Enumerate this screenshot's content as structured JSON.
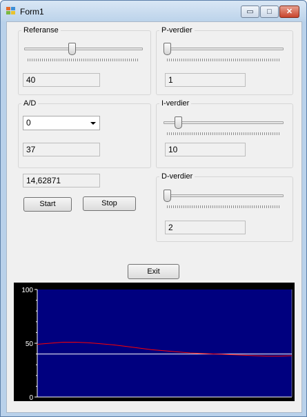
{
  "window": {
    "title": "Form1"
  },
  "controls": {
    "minimize": "▭",
    "maximize": "□",
    "close": "✕"
  },
  "referanse": {
    "label": "Referanse",
    "slider_value": 40,
    "slider_max": 100,
    "value": "40"
  },
  "p_verdier": {
    "label": "P-verdier",
    "slider_value": 0,
    "slider_max": 100,
    "value": "1"
  },
  "ad": {
    "label": "A/D",
    "combo_value": "0",
    "value": "37"
  },
  "i_verdier": {
    "label": "I-verdier",
    "slider_value": 10,
    "slider_max": 100,
    "value": "10"
  },
  "output_value": "14,62871",
  "buttons": {
    "start": "Start",
    "stop": "Stop",
    "exit": "Exit"
  },
  "d_verdier": {
    "label": "D-verdier",
    "slider_value": 0,
    "slider_max": 100,
    "value": "2"
  },
  "colors": {
    "plot_bg": "#00007f",
    "frame_bg": "#000000",
    "setpoint_line": "#ffffff",
    "output_line": "#ff0000"
  },
  "chart_data": {
    "type": "line",
    "ylim": [
      0,
      100
    ],
    "yticks": [
      "100",
      "50",
      "0"
    ],
    "series": [
      {
        "x": [
          0,
          5,
          10,
          15,
          20,
          25,
          30,
          35,
          40,
          45,
          50,
          55,
          60,
          65,
          70,
          75,
          80,
          85,
          90,
          95,
          100
        ],
        "values": [
          49,
          50,
          51,
          51,
          50.5,
          49.5,
          48.5,
          47,
          45.5,
          44,
          43,
          42,
          41,
          40.5,
          40,
          39.5,
          39,
          38.5,
          38,
          38,
          38.5
        ]
      },
      {
        "x": [
          0,
          100
        ],
        "values": [
          40,
          40
        ]
      }
    ]
  }
}
